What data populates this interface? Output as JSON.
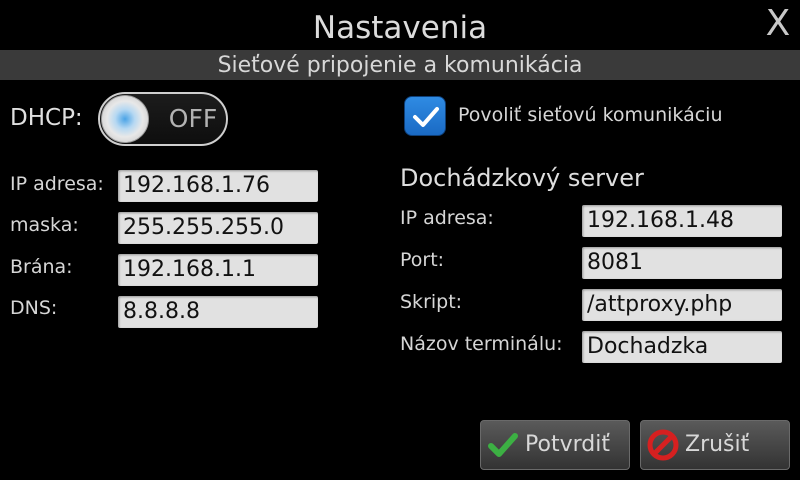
{
  "header": {
    "title": "Nastavenia",
    "close_glyph": "X",
    "subtitle": "Sieťové pripojenie a komunikácia"
  },
  "network": {
    "dhcp_label": "DHCP:",
    "dhcp_state": "OFF",
    "rows": [
      {
        "label": "IP adresa:",
        "value": "192.168.1.76"
      },
      {
        "label": "maska:",
        "value": "255.255.255.0"
      },
      {
        "label": "Brána:",
        "value": "192.168.1.1"
      },
      {
        "label": "DNS:",
        "value": "8.8.8.8"
      }
    ]
  },
  "communication": {
    "enable_label": "Povoliť sieťovú komunikáciu",
    "enabled": true
  },
  "attendance_server": {
    "title": "Dochádzkový server",
    "rows": [
      {
        "label": "IP adresa:",
        "value": "192.168.1.48"
      },
      {
        "label": "Port:",
        "value": "8081"
      },
      {
        "label": "Skript:",
        "value": "/attproxy.php"
      },
      {
        "label": "Názov terminálu:",
        "value": "Dochadzka"
      }
    ]
  },
  "buttons": {
    "confirm_label": "Potvrdiť",
    "cancel_label": "Zrušiť"
  },
  "colors": {
    "background": "#000000",
    "subtitle_bar": "#3a3a3a",
    "field_bg": "#e1e1e1",
    "checkbox_blue": "#2f8be3",
    "confirm_icon_green": "#3cb043",
    "cancel_icon_red": "#d62020"
  },
  "icons": {
    "confirm": "check-icon",
    "cancel": "no-entry-icon",
    "close": "close-icon",
    "checkbox": "checkmark-icon"
  }
}
